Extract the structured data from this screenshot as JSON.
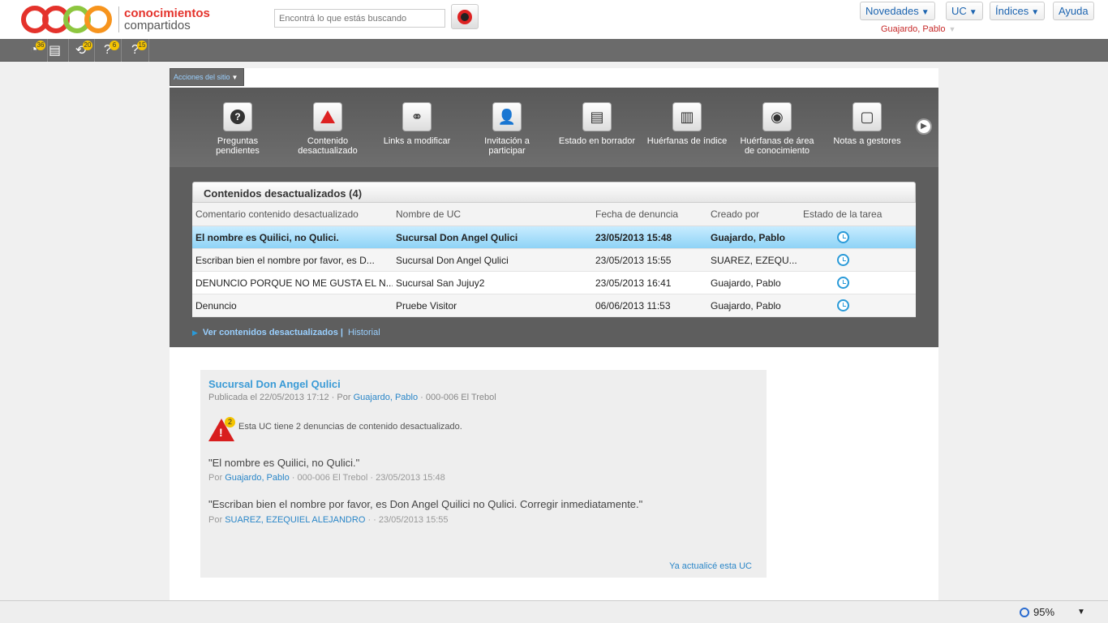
{
  "header": {
    "logo_line1": "conocimientos",
    "logo_line2": "compartidos",
    "search_placeholder": "Encontrá lo que estás buscando",
    "nav": [
      {
        "label": "Novedades",
        "arrow": "▼"
      },
      {
        "label": "UC",
        "arrow": "▼"
      },
      {
        "label": "Índices",
        "arrow": "▼"
      },
      {
        "label": "Ayuda",
        "arrow": ""
      }
    ],
    "user": "Guajardo, Pablo",
    "user_caret": "▼"
  },
  "iconbar": {
    "items": [
      {
        "icon": "dashboard-icon",
        "glyph": "◔",
        "badge": "36"
      },
      {
        "icon": "document-icon",
        "glyph": "▤",
        "badge": ""
      },
      {
        "icon": "refresh-icon",
        "glyph": "⟲",
        "badge": "20"
      },
      {
        "icon": "help-cursor-icon",
        "glyph": "?",
        "badge": "6"
      },
      {
        "icon": "question-icon",
        "glyph": "?",
        "badge": "15"
      }
    ]
  },
  "site_actions": {
    "label": "Acciones del sitio",
    "caret": "▼"
  },
  "tools": [
    {
      "icon": "question-circle-icon",
      "glyph": "?",
      "label": "Preguntas pendientes"
    },
    {
      "icon": "warning-icon",
      "glyph": "!",
      "label": "Contenido desactualizado"
    },
    {
      "icon": "link-icon",
      "glyph": "⚭",
      "label": "Links a modificar"
    },
    {
      "icon": "add-user-icon",
      "glyph": "👤",
      "label": "Invitación a participar"
    },
    {
      "icon": "draft-document-icon",
      "glyph": "▤",
      "label": "Estado en borrador"
    },
    {
      "icon": "orphan-index-icon",
      "glyph": "▥",
      "label": "Huérfanas de índice"
    },
    {
      "icon": "orphan-area-icon",
      "glyph": "◉",
      "label": "Huérfanas de área de conocimiento"
    },
    {
      "icon": "notes-icon",
      "glyph": "▢",
      "label": "Notas a gestores"
    }
  ],
  "tool_next": "▶",
  "table": {
    "title": "Contenidos desactualizados (4)",
    "columns": [
      "Comentario contenido desactualizado",
      "Nombre de UC",
      "Fecha de denuncia",
      "Creado por",
      "Estado de la tarea"
    ],
    "rows": [
      {
        "comment": "El nombre es Quilici, no Qulici.",
        "uc": "Sucursal Don Angel Qulici",
        "date": "23/05/2013 15:48",
        "creator": "Guajardo, Pablo",
        "status_icon": "clock-icon"
      },
      {
        "comment": "Escriban bien el nombre por favor, es D...",
        "uc": "Sucursal Don Angel Qulici",
        "date": "23/05/2013 15:55",
        "creator": "SUAREZ, EZEQU...",
        "status_icon": "clock-icon"
      },
      {
        "comment": "DENUNCIO PORQUE NO ME GUSTA EL N...",
        "uc": "Sucursal San Jujuy2",
        "date": "23/05/2013 16:41",
        "creator": "Guajardo, Pablo",
        "status_icon": "clock-icon"
      },
      {
        "comment": "Denuncio",
        "uc": "Pruebe Visitor",
        "date": "06/06/2013 11:53",
        "creator": "Guajardo, Pablo",
        "status_icon": "clock-icon"
      }
    ],
    "link_all": "Ver contenidos desactualizados |",
    "link_history": "Historial"
  },
  "detail": {
    "title": "Sucursal Don Angel Qulici",
    "meta_prefix": "Publicada el 22/05/2013 17:12 · Por",
    "meta_author": "Guajardo, Pablo",
    "meta_suffix": "· 000-006 El Trebol",
    "warn_badge": "2",
    "warn_text": "Esta UC tiene 2 denuncias de contenido desactualizado.",
    "comments": [
      {
        "quote": "\"El nombre es Quilici, no Qulici.\"",
        "by": "Por",
        "author": "Guajardo, Pablo",
        "suffix": "· 000-006 El Trebol · 23/05/2013 15:48"
      },
      {
        "quote": "\"Escriban bien el nombre por favor, es Don Angel Quilici no Qulici. Corregir inmediatamente.\"",
        "by": "Por",
        "author": "SUAREZ, EZEQUIEL ALEJANDRO",
        "suffix": "· · 23/05/2013 15:55"
      }
    ],
    "done_label": "Ya actualicé esta UC"
  },
  "statusbar": {
    "zoom": "95%",
    "zoom_caret": "▼"
  },
  "colors": {
    "accent": "#2a86c8",
    "brand_red": "#e4322b",
    "panel": "#5e5e5e",
    "selected_row": "#8ed3f6"
  }
}
